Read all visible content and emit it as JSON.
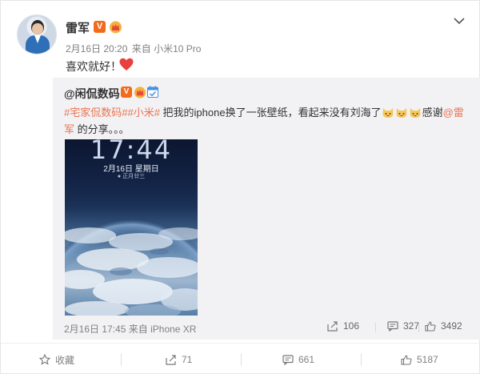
{
  "post": {
    "author": "雷军",
    "verified_badge": "V",
    "time": "2月16日 20:20",
    "source_prefix": "来自",
    "source": "小米10 Pro",
    "text": "喜欢就好！",
    "icons": {
      "heart": "red-heart-icon",
      "crown": "crown-icon",
      "more": "chevron-down-icon"
    }
  },
  "repost": {
    "author": "@闲侃数码",
    "verified_badge": "V",
    "tags": "#宅家侃数码##小米#",
    "text_1": " 把我的iphone换了一张壁纸，看起来没有刘海了",
    "text_2": "感谢",
    "mention": "@雷军",
    "text_3": " 的分享。。。",
    "image": {
      "time": "17:44",
      "date": "2月16日 星期日",
      "lunar": "● 正月廿三"
    },
    "time": "2月16日 17:45",
    "source_prefix": "来自",
    "source": "iPhone XR",
    "reposts": "106",
    "comments": "327",
    "likes": "3492"
  },
  "actions": {
    "collect": "收藏",
    "repost": "71",
    "comment": "661",
    "like": "5187"
  },
  "colors": {
    "link": "#eb7350",
    "badge": "#f26a1b",
    "repost_bg": "#f2f2f5"
  }
}
